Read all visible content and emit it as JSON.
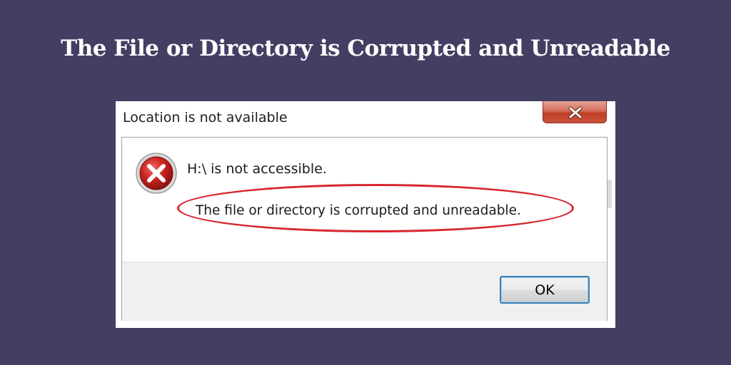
{
  "banner": {
    "title": "The File or Directory is Corrupted and Unreadable"
  },
  "dialog": {
    "title": "Location is not available",
    "close_icon": "close-x-icon",
    "error_icon": "error-red-x-icon",
    "message_primary": "H:\\ is not accessible.",
    "message_secondary": "The file or directory is corrupted and unreadable.",
    "ok_label": "OK"
  },
  "colors": {
    "background": "#433f63",
    "highlight": "#d8262e",
    "error_red": "#c0262b"
  }
}
